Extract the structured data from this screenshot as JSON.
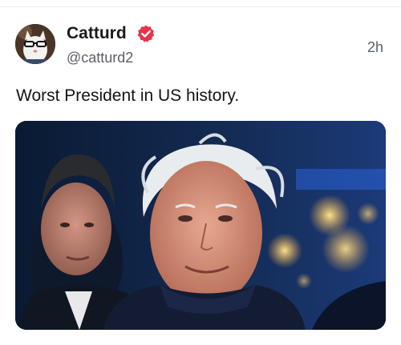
{
  "post": {
    "author": {
      "display_name": "Catturd",
      "handle": "@catturd2",
      "verified_badge_color": "#e8334a"
    },
    "timestamp": "2h",
    "text": "Worst President in US history."
  },
  "icons": {
    "avatar": "cat-with-glasses-avatar",
    "badge": "verified-badge-icon"
  }
}
